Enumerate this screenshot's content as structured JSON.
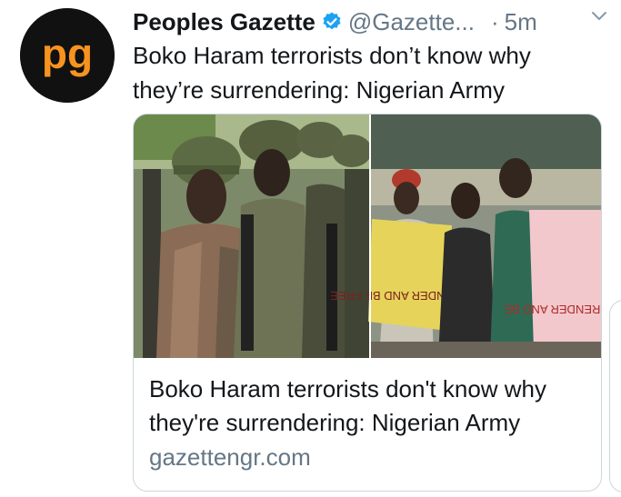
{
  "tweet": {
    "author_name": "Peoples Gazette",
    "handle": "@Gazette...",
    "separator": "·",
    "time": "5m",
    "text": "Boko Haram terrorists don’t know why they’re surrendering: Nigerian Army",
    "avatar_logo": "pg",
    "icons": {
      "verified": "verified-badge-icon",
      "menu": "chevron-down-icon"
    }
  },
  "card": {
    "title": "Boko Haram terrorists don't know why they're surrendering: Nigerian Army",
    "domain": "gazettengr.com",
    "image_left": "soldiers-in-helmets",
    "image_right": "men-holding-signs",
    "sign_left_text": "SURRENDER AND BE FREE",
    "sign_right_text": "SURRENDER AND BE"
  },
  "colors": {
    "brand_orange": "#f7931e",
    "verified_blue": "#1da1f2",
    "secondary_text": "#657786"
  }
}
